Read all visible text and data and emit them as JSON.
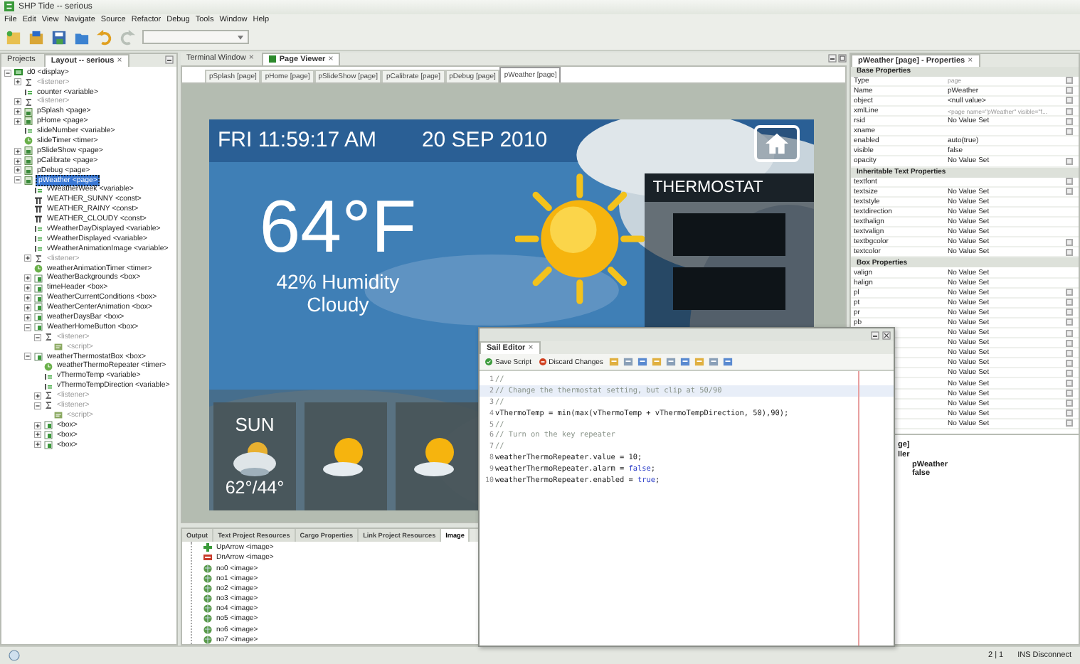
{
  "window": {
    "title": "SHP Tide -- serious"
  },
  "menu": [
    "File",
    "Edit",
    "View",
    "Navigate",
    "Source",
    "Refactor",
    "Debug",
    "Tools",
    "Window",
    "Help"
  ],
  "layout_panel": {
    "tabs": [
      {
        "label": "Projects",
        "selected": false
      },
      {
        "label": "Layout -- serious",
        "selected": true
      }
    ],
    "close": "×",
    "tree": [
      {
        "label": "d0 <display>",
        "kind": "display",
        "selected": false,
        "expanded": true,
        "children": [
          {
            "label": "<listener>",
            "kind": "listener",
            "selected": false,
            "expanded": false
          },
          {
            "label": "counter <variable>",
            "kind": "variable",
            "selected": false
          },
          {
            "label": "<listener>",
            "kind": "listener",
            "selected": false,
            "expanded": false
          },
          {
            "label": "pSplash <page>",
            "kind": "page",
            "selected": false,
            "expanded": false
          },
          {
            "label": "pHome <page>",
            "kind": "page",
            "selected": false,
            "expanded": false
          },
          {
            "label": "slideNumber <variable>",
            "kind": "variable",
            "selected": false
          },
          {
            "label": "slideTimer <timer>",
            "kind": "timer",
            "selected": false
          },
          {
            "label": "pSlideShow <page>",
            "kind": "page",
            "selected": false,
            "expanded": false
          },
          {
            "label": "pCalibrate <page>",
            "kind": "page",
            "selected": false,
            "expanded": false
          },
          {
            "label": "pDebug <page>",
            "kind": "page",
            "selected": false,
            "expanded": false
          },
          {
            "label": "pWeather <page>",
            "kind": "page",
            "selected": true,
            "expanded": true,
            "children": [
              {
                "label": "vWeatherWeek <variable>",
                "kind": "variable",
                "selected": false
              },
              {
                "label": "WEATHER_SUNNY <const>",
                "kind": "const",
                "selected": false
              },
              {
                "label": "WEATHER_RAINY <const>",
                "kind": "const",
                "selected": false
              },
              {
                "label": "WEATHER_CLOUDY <const>",
                "kind": "const",
                "selected": false
              },
              {
                "label": "vWeatherDayDisplayed <variable>",
                "kind": "variable",
                "selected": false
              },
              {
                "label": "vWeatherDisplayed <variable>",
                "kind": "variable",
                "selected": false
              },
              {
                "label": "vWeatherAnimationImage <variable>",
                "kind": "variable",
                "selected": false
              },
              {
                "label": "<listener>",
                "kind": "listener",
                "selected": false,
                "expanded": false
              },
              {
                "label": "weatherAnimationTimer <timer>",
                "kind": "timer",
                "selected": false
              },
              {
                "label": "WeatherBackgrounds <box>",
                "kind": "box",
                "selected": false,
                "expanded": false
              },
              {
                "label": "timeHeader <box>",
                "kind": "box",
                "selected": false,
                "expanded": false
              },
              {
                "label": "WeatherCurrentConditions <box>",
                "kind": "box",
                "selected": false,
                "expanded": false
              },
              {
                "label": "WeatherCenterAnimation <box>",
                "kind": "box",
                "selected": false,
                "expanded": false
              },
              {
                "label": "weatherDaysBar <box>",
                "kind": "box",
                "selected": false,
                "expanded": false
              },
              {
                "label": "WeatherHomeButton <box>",
                "kind": "box",
                "selected": false,
                "expanded": true,
                "children": [
                  {
                    "label": "<listener>",
                    "kind": "listener",
                    "selected": false,
                    "expanded": true,
                    "children": [
                      {
                        "label": "<script>",
                        "kind": "script",
                        "selected": false
                      }
                    ]
                  }
                ]
              },
              {
                "label": "weatherThermostatBox <box>",
                "kind": "box",
                "selected": false,
                "expanded": true,
                "children": [
                  {
                    "label": "weatherThermoRepeater <timer>",
                    "kind": "timer",
                    "selected": false
                  },
                  {
                    "label": "vThermoTemp <variable>",
                    "kind": "variable",
                    "selected": false
                  },
                  {
                    "label": "vThermoTempDirection <variable>",
                    "kind": "variable",
                    "selected": false
                  },
                  {
                    "label": "<listener>",
                    "kind": "listener",
                    "selected": false,
                    "expanded": false
                  },
                  {
                    "label": "<listener>",
                    "kind": "listener",
                    "selected": false,
                    "expanded": true,
                    "children": [
                      {
                        "label": "<script>",
                        "kind": "script",
                        "selected": false
                      }
                    ]
                  },
                  {
                    "label": "<box>",
                    "kind": "box",
                    "selected": false,
                    "expanded": false
                  },
                  {
                    "label": "<box>",
                    "kind": "box",
                    "selected": false,
                    "expanded": false
                  },
                  {
                    "label": "<box>",
                    "kind": "box",
                    "selected": false,
                    "expanded": false
                  }
                ]
              }
            ]
          }
        ]
      }
    ]
  },
  "viewer": {
    "tabs": [
      {
        "label": "Terminal Window",
        "selected": false
      },
      {
        "label": "Page Viewer",
        "selected": true
      }
    ],
    "close": "×",
    "page_tabs": [
      {
        "label": "pSplash [page]",
        "selected": false
      },
      {
        "label": "pHome [page]",
        "selected": false
      },
      {
        "label": "pSlideShow [page]",
        "selected": false
      },
      {
        "label": "pCalibrate [page]",
        "selected": false
      },
      {
        "label": "pDebug [page]",
        "selected": false
      },
      {
        "label": "pWeather [page]",
        "selected": true
      }
    ],
    "device": {
      "time": "FRI 11:59:17 AM",
      "date": "20 SEP 2010",
      "temperature": "64°F",
      "humidity": "42% Humidity",
      "condition": "Cloudy",
      "thermostat_title": "THERMOSTAT",
      "forecast": [
        {
          "day": "SUN",
          "temps": "62°/44°",
          "kind": "cloudy"
        },
        {
          "kind": "partly-sunny"
        },
        {
          "kind": "partly-sunny"
        }
      ]
    }
  },
  "resources": {
    "tabs": [
      {
        "label": "Output",
        "selected": false
      },
      {
        "label": "Text Project Resources",
        "selected": false
      },
      {
        "label": "Cargo Properties",
        "selected": false
      },
      {
        "label": "Link Project Resources",
        "selected": false
      },
      {
        "label": "Image",
        "selected": true
      }
    ],
    "images": [
      {
        "label": "UpArrow <image>",
        "kind": "up"
      },
      {
        "label": "DnArrow <image>",
        "kind": "down"
      },
      {
        "label": "no0 <image>"
      },
      {
        "label": "no1 <image>"
      },
      {
        "label": "no2 <image>"
      },
      {
        "label": "no3 <image>"
      },
      {
        "label": "no4 <image>"
      },
      {
        "label": "no5 <image>"
      },
      {
        "label": "no6 <image>"
      },
      {
        "label": "no7 <image>"
      }
    ]
  },
  "properties": {
    "title": "pWeather [page] - Properties",
    "close": "×",
    "sections": [
      {
        "title": "Base Properties",
        "rows": [
          {
            "name": "Type",
            "value": "page",
            "muted": true,
            "has_button": true
          },
          {
            "name": "Name",
            "value": "pWeather",
            "muted": false,
            "has_button": true
          },
          {
            "name": "object",
            "value": "<null value>",
            "muted": false,
            "has_button": true
          },
          {
            "name": "xmlLine",
            "value": "<page name=\"pWeather\" visible=\"f...",
            "muted": true,
            "has_button": true
          },
          {
            "name": "rsid",
            "value": "No Value Set",
            "muted": false,
            "has_button": true
          },
          {
            "name": "xname",
            "has_button": true
          },
          {
            "name": "enabled",
            "value": "auto(true)",
            "muted": false,
            "has_button": false
          },
          {
            "name": "visible",
            "value": "false",
            "muted": false,
            "has_button": false
          },
          {
            "name": "opacity",
            "value": "No Value Set",
            "muted": false,
            "has_button": true
          }
        ]
      },
      {
        "title": "Inheritable Text Properties",
        "rows": [
          {
            "name": "textfont",
            "has_button": true
          },
          {
            "name": "textsize",
            "value": "No Value Set",
            "muted": false,
            "has_button": true
          },
          {
            "name": "textstyle",
            "value": "No Value Set",
            "muted": false,
            "has_button": false
          },
          {
            "name": "textdirection",
            "value": "No Value Set",
            "muted": false,
            "has_button": false
          },
          {
            "name": "texthalign",
            "value": "No Value Set",
            "muted": false,
            "has_button": false
          },
          {
            "name": "textvalign",
            "value": "No Value Set",
            "muted": false,
            "has_button": false
          },
          {
            "name": "textbgcolor",
            "value": "No Value Set",
            "muted": false,
            "has_button": true
          },
          {
            "name": "textcolor",
            "value": "No Value Set",
            "muted": false,
            "has_button": true
          }
        ]
      },
      {
        "title": "Box Properties",
        "rows": [
          {
            "name": "valign",
            "value": "No Value Set",
            "muted": false,
            "has_button": false
          },
          {
            "name": "halign",
            "value": "No Value Set",
            "muted": false,
            "has_button": false
          },
          {
            "name": "pl",
            "value": "No Value Set",
            "muted": false,
            "has_button": true
          },
          {
            "name": "pt",
            "value": "No Value Set",
            "muted": false,
            "has_button": true
          },
          {
            "name": "pr",
            "value": "No Value Set",
            "muted": false,
            "has_button": true
          },
          {
            "name": "pb",
            "value": "No Value Set",
            "muted": false,
            "has_button": true
          },
          {
            "value": "No Value Set",
            "muted": false,
            "has_button": true
          },
          {
            "value": "No Value Set",
            "muted": false,
            "has_button": true
          },
          {
            "value": "No Value Set",
            "muted": false,
            "has_button": true
          },
          {
            "value": "No Value Set",
            "muted": false,
            "has_button": true
          },
          {
            "value": "No Value Set",
            "muted": false,
            "has_button": true
          },
          {
            "value": "No Value Set",
            "muted": false,
            "has_button": true
          },
          {
            "value": "No Value Set",
            "muted": false,
            "has_button": true
          },
          {
            "value": "No Value Set",
            "muted": false,
            "has_button": true
          },
          {
            "value": "No Value Set",
            "muted": false,
            "has_button": true
          },
          {
            "value": "No Value Set",
            "muted": false,
            "has_button": true
          }
        ]
      }
    ]
  },
  "navigator": {
    "lines": [
      "ge]",
      "ller"
    ],
    "items": [
      "pWeather",
      "false"
    ]
  },
  "sail_editor": {
    "tab": "Sail Editor",
    "close": "×",
    "buttons": [
      {
        "label": "Save Script",
        "kind": "save"
      },
      {
        "label": "Discard Changes",
        "kind": "discard"
      }
    ],
    "lines": [
      {
        "num": "1",
        "selected": false,
        "parts": [
          {
            "kind": "comment",
            "text": "//"
          }
        ]
      },
      {
        "num": "2",
        "selected": true,
        "parts": [
          {
            "kind": "comment",
            "text": "// Change the thermostat setting, but clip at 50/90"
          }
        ]
      },
      {
        "num": "3",
        "selected": false,
        "parts": [
          {
            "kind": "comment",
            "text": "//"
          }
        ]
      },
      {
        "num": "4",
        "selected": false,
        "parts": [
          {
            "kind": "code",
            "text": "vThermoTemp = min(max(vThermoTemp + vThermoTempDirection, 50),90);"
          }
        ]
      },
      {
        "num": "5",
        "selected": false,
        "parts": [
          {
            "kind": "comment",
            "text": "//"
          }
        ]
      },
      {
        "num": "6",
        "selected": false,
        "parts": [
          {
            "kind": "comment",
            "text": "// Turn on the key repeater"
          }
        ]
      },
      {
        "num": "7",
        "selected": false,
        "parts": [
          {
            "kind": "comment",
            "text": "//"
          }
        ]
      },
      {
        "num": "8",
        "selected": false,
        "parts": [
          {
            "kind": "code",
            "text": "weatherThermoRepeater.value = 10;"
          }
        ]
      },
      {
        "num": "9",
        "selected": false,
        "parts": [
          {
            "kind": "code",
            "text": "weatherThermoRepeater.alarm = "
          },
          {
            "kind": "keyword",
            "text": "false"
          },
          {
            "kind": "code",
            "text": ";"
          }
        ]
      },
      {
        "num": "10",
        "selected": false,
        "parts": [
          {
            "kind": "code",
            "text": "weatherThermoRepeater.enabled = "
          },
          {
            "kind": "keyword",
            "text": "true"
          },
          {
            "kind": "code",
            "text": ";"
          }
        ]
      }
    ]
  },
  "status_bar": {
    "position": "2 | 1",
    "mode": "INS Disconnect"
  }
}
